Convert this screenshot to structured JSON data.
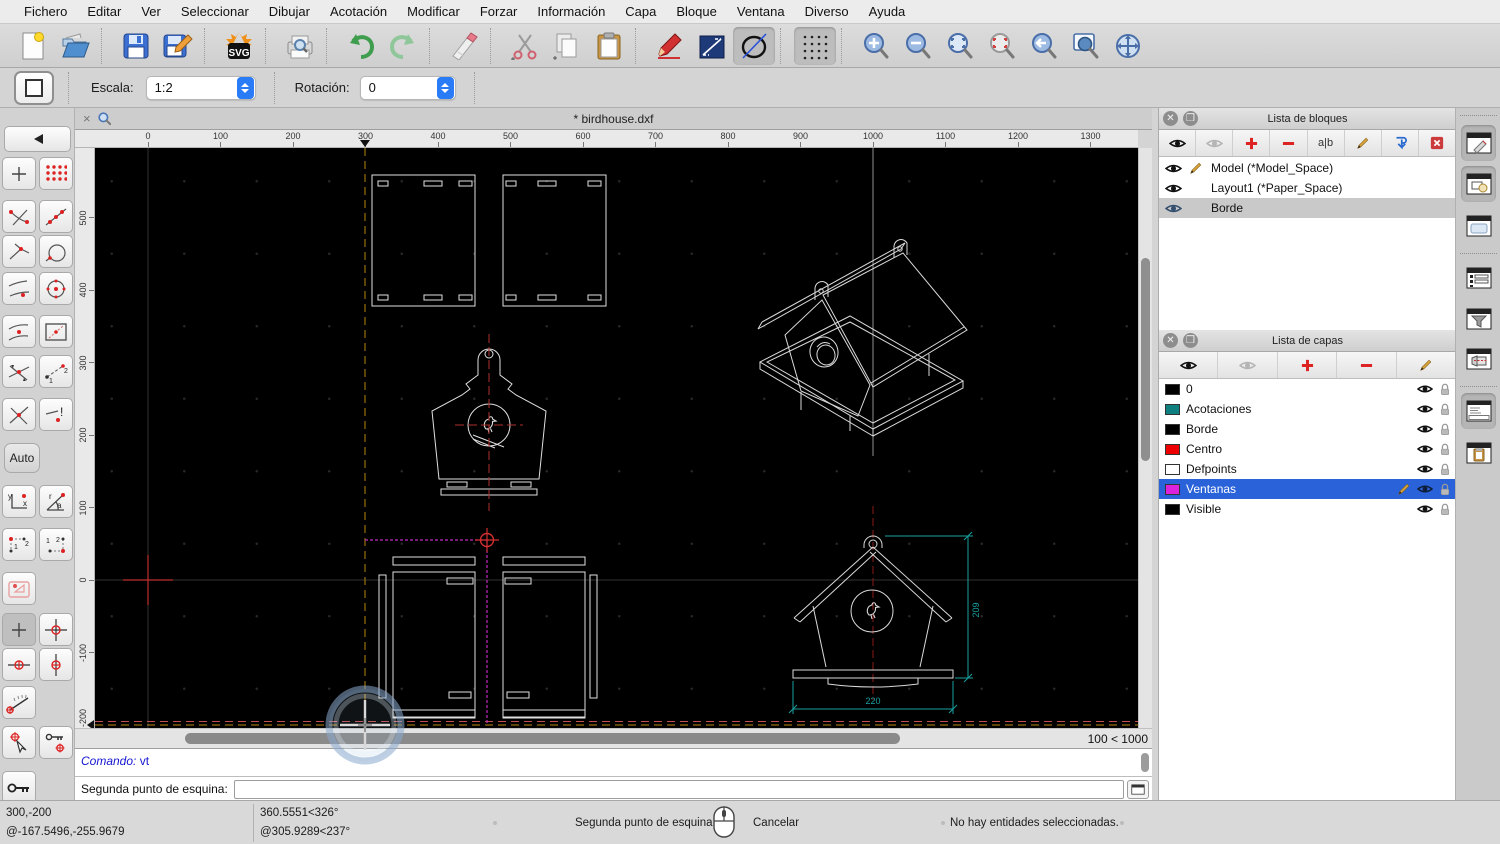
{
  "menubar": {
    "items": [
      "Fichero",
      "Editar",
      "Ver",
      "Seleccionar",
      "Dibujar",
      "Acotación",
      "Modificar",
      "Forzar",
      "Información",
      "Capa",
      "Bloque",
      "Ventana",
      "Diverso",
      "Ayuda"
    ]
  },
  "toolbar_main": {
    "buttons": [
      "new-file",
      "open-file",
      "save",
      "save-as",
      "export-svg",
      "print-preview",
      "undo",
      "redo",
      "erase",
      "cut",
      "copy",
      "paste",
      "draw-pencil",
      "line-tool",
      "ellipse-tool",
      "grid-toggle",
      "zoom-in",
      "zoom-out",
      "zoom-auto",
      "zoom-selection",
      "zoom-previous",
      "zoom-window",
      "zoom-pan"
    ],
    "active_buttons": [
      "ellipse-tool",
      "grid-toggle"
    ]
  },
  "options_bar": {
    "scale_label": "Escala:",
    "scale_value": "1:2",
    "rotation_label": "Rotación:",
    "rotation_value": "0"
  },
  "snap_palette": {
    "auto_label": "Auto"
  },
  "document_tab": {
    "close": "×",
    "title": "* birdhouse.dxf"
  },
  "rulers": {
    "horizontal": [
      "0",
      "100",
      "200",
      "300",
      "400",
      "500",
      "600",
      "700",
      "800",
      "900",
      "1000",
      "1100",
      "1200",
      "1300"
    ],
    "vertical": [
      "500",
      "400",
      "300",
      "200",
      "100",
      "0",
      "-100",
      "-200"
    ]
  },
  "zoom_indicator": "100 < 1000",
  "blocks_panel": {
    "title": "Lista de bloques",
    "rename_label": "a|b",
    "rows": [
      {
        "name": "Model (*Model_Space)",
        "editing": true
      },
      {
        "name": "Layout1 (*Paper_Space)",
        "editing": false
      },
      {
        "name": "Borde",
        "selected": true
      }
    ]
  },
  "layers_panel": {
    "title": "Lista de capas",
    "rows": [
      {
        "name": "0",
        "color": "#000000"
      },
      {
        "name": "Acotaciones",
        "color": "#0e8080"
      },
      {
        "name": "Borde",
        "color": "#000000"
      },
      {
        "name": "Centro",
        "color": "#ee0000"
      },
      {
        "name": "Defpoints",
        "color": "#ffffff"
      },
      {
        "name": "Ventanas",
        "color": "#dd22dd",
        "selected": true
      },
      {
        "name": "Visible",
        "color": "#000000"
      }
    ]
  },
  "drawing": {
    "dimensions": {
      "width": "220",
      "height": "209"
    },
    "colors": {
      "entity": "#e0e0e0",
      "dimension": "#18a0a0",
      "centerline": "#8b1a1a",
      "selection": "#c128c1",
      "crosshair": "#b8860b",
      "origin": "#c03030"
    }
  },
  "command_line": {
    "history_label": "Comando:",
    "history_value": "vt",
    "prompt": "Segunda punto de esquina:",
    "input_value": ""
  },
  "status_bar": {
    "coord_abs": "300,-200",
    "coord_rel": "@-167.5496,-255.9679",
    "polar_abs": "360.5551<326°",
    "polar_rel": "@305.9289<237°",
    "mouse_left_hint": "Segunda punto de esquina",
    "mouse_right_hint": "Cancelar",
    "selection_status": "No hay entidades seleccionadas."
  }
}
